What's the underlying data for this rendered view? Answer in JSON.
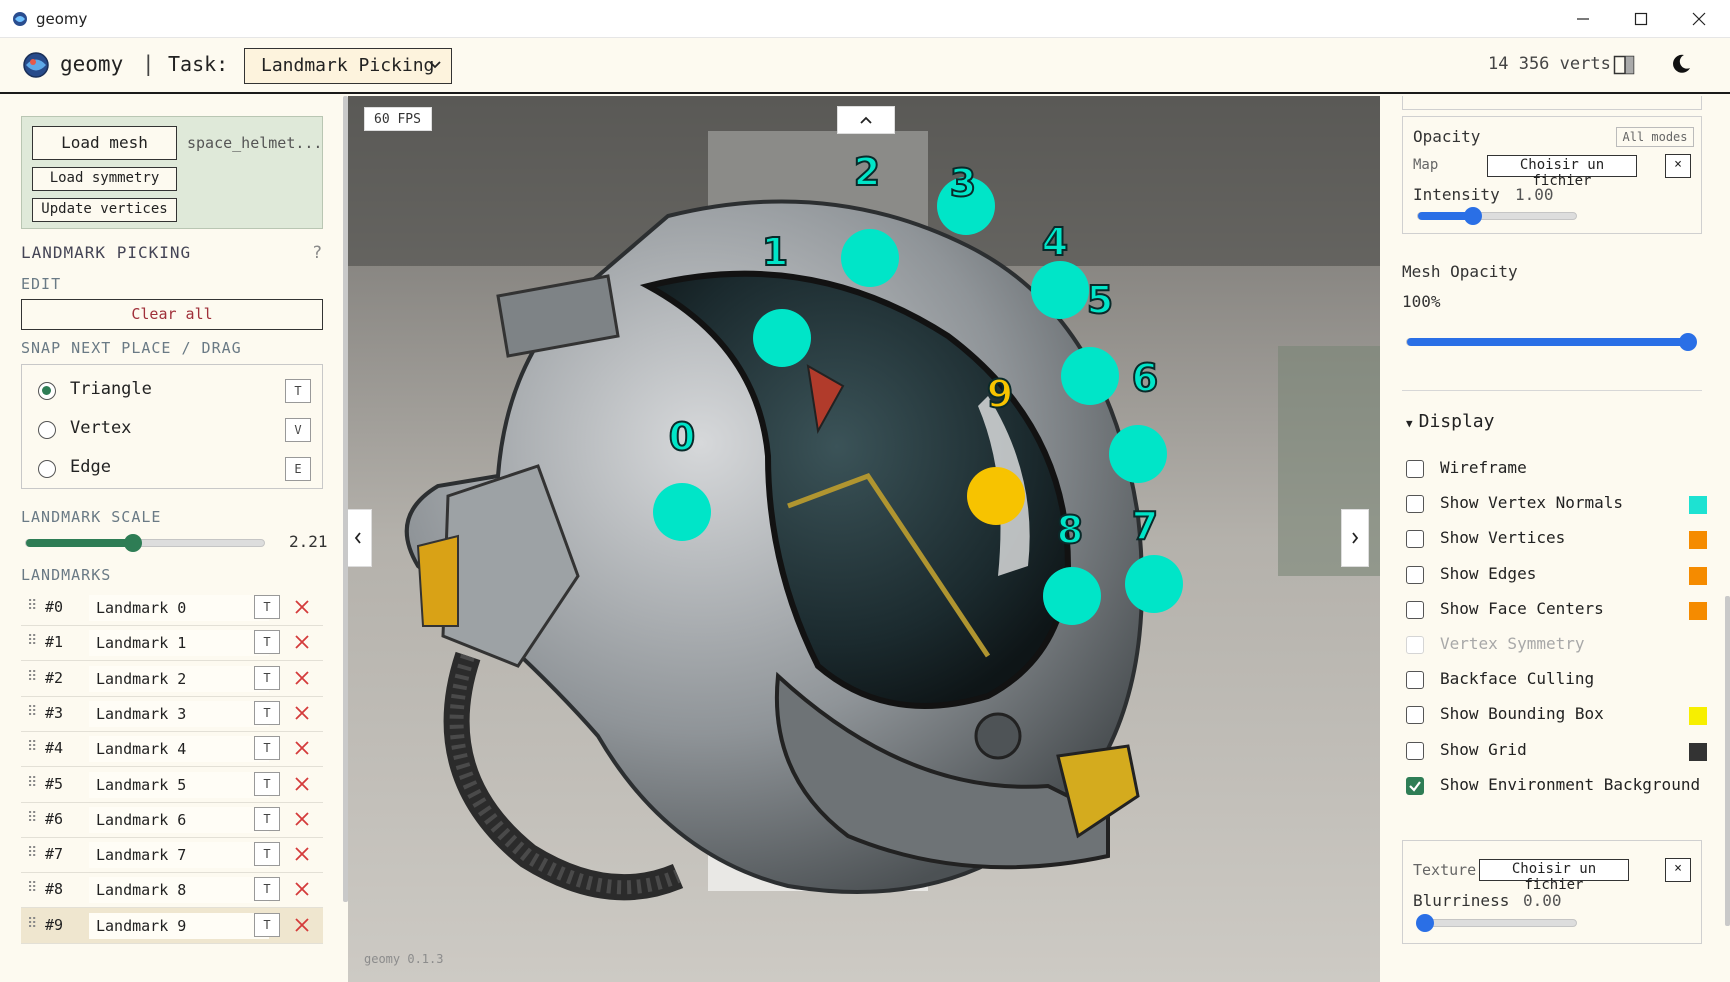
{
  "window": {
    "title": "geomy"
  },
  "header": {
    "app_name": "geomy",
    "separator": "|",
    "task_label": "Task:",
    "task_value": "Landmark Picking",
    "vert_count": "14 356 verts"
  },
  "left": {
    "load_mesh": "Load mesh",
    "file_name": "space_helmet...",
    "load_symmetry": "Load symmetry",
    "update_vertices": "Update vertices",
    "section_title": "LANDMARK PICKING",
    "help": "?",
    "edit_label": "EDIT",
    "clear_all": "Clear all",
    "snap_label": "SNAP NEXT PLACE / DRAG",
    "snap_options": [
      {
        "label": "Triangle",
        "key": "T",
        "selected": true
      },
      {
        "label": "Vertex",
        "key": "V",
        "selected": false
      },
      {
        "label": "Edge",
        "key": "E",
        "selected": false
      }
    ],
    "scale_label": "LANDMARK SCALE",
    "scale_value": "2.21",
    "scale_fraction": 0.45,
    "landmarks_label": "LANDMARKS",
    "landmarks": [
      {
        "index": "#0",
        "name": "Landmark 0",
        "key": "T"
      },
      {
        "index": "#1",
        "name": "Landmark 1",
        "key": "T"
      },
      {
        "index": "#2",
        "name": "Landmark 2",
        "key": "T"
      },
      {
        "index": "#3",
        "name": "Landmark 3",
        "key": "T"
      },
      {
        "index": "#4",
        "name": "Landmark 4",
        "key": "T"
      },
      {
        "index": "#5",
        "name": "Landmark 5",
        "key": "T"
      },
      {
        "index": "#6",
        "name": "Landmark 6",
        "key": "T"
      },
      {
        "index": "#7",
        "name": "Landmark 7",
        "key": "T"
      },
      {
        "index": "#8",
        "name": "Landmark 8",
        "key": "T"
      },
      {
        "index": "#9",
        "name": "Landmark 9",
        "key": "T"
      }
    ],
    "selected_landmark": 9
  },
  "viewport": {
    "fps": "60 FPS",
    "version": "geomy 0.1.3",
    "landmark_color": "#00e5c8",
    "selected_color": "#f7c300",
    "marker_labels": [
      "0",
      "1",
      "2",
      "3",
      "4",
      "5",
      "6",
      "7",
      "8",
      "9"
    ]
  },
  "right": {
    "opacity_title": "Opacity",
    "all_modes": "All modes",
    "map_label": "Map",
    "choose_file": "Choisir un fichier",
    "clear_x": "×",
    "intensity_label": "Intensity",
    "intensity_value": "1.00",
    "intensity_fraction": 0.35,
    "mesh_opacity_label": "Mesh Opacity",
    "mesh_opacity_value": "100%",
    "mesh_opacity_fraction": 1.0,
    "display_title": "Display",
    "options": [
      {
        "label": "Wireframe",
        "checked": false,
        "disabled": false,
        "color": null
      },
      {
        "label": "Show Vertex Normals",
        "checked": false,
        "disabled": false,
        "color": "#1de2d2"
      },
      {
        "label": "Show Vertices",
        "checked": false,
        "disabled": false,
        "color": "#f58b00"
      },
      {
        "label": "Show Edges",
        "checked": false,
        "disabled": false,
        "color": "#f58b00"
      },
      {
        "label": "Show Face Centers",
        "checked": false,
        "disabled": false,
        "color": "#f58b00"
      },
      {
        "label": "Vertex Symmetry",
        "checked": false,
        "disabled": true,
        "color": null
      },
      {
        "label": "Backface Culling",
        "checked": false,
        "disabled": false,
        "color": null
      },
      {
        "label": "Show Bounding Box",
        "checked": false,
        "disabled": false,
        "color": "#f7ef00"
      },
      {
        "label": "Show Grid",
        "checked": false,
        "disabled": false,
        "color": "#333333"
      },
      {
        "label": "Show Environment Background",
        "checked": true,
        "disabled": false,
        "color": null
      }
    ],
    "texture_label": "Texture",
    "blurriness_label": "Blurriness",
    "blurriness_value": "0.00",
    "blurriness_fraction": 0.0
  },
  "colors": {
    "accent_blue": "#2a6fe6",
    "accent_green": "#2e7d55",
    "danger": "#d43b3b"
  }
}
